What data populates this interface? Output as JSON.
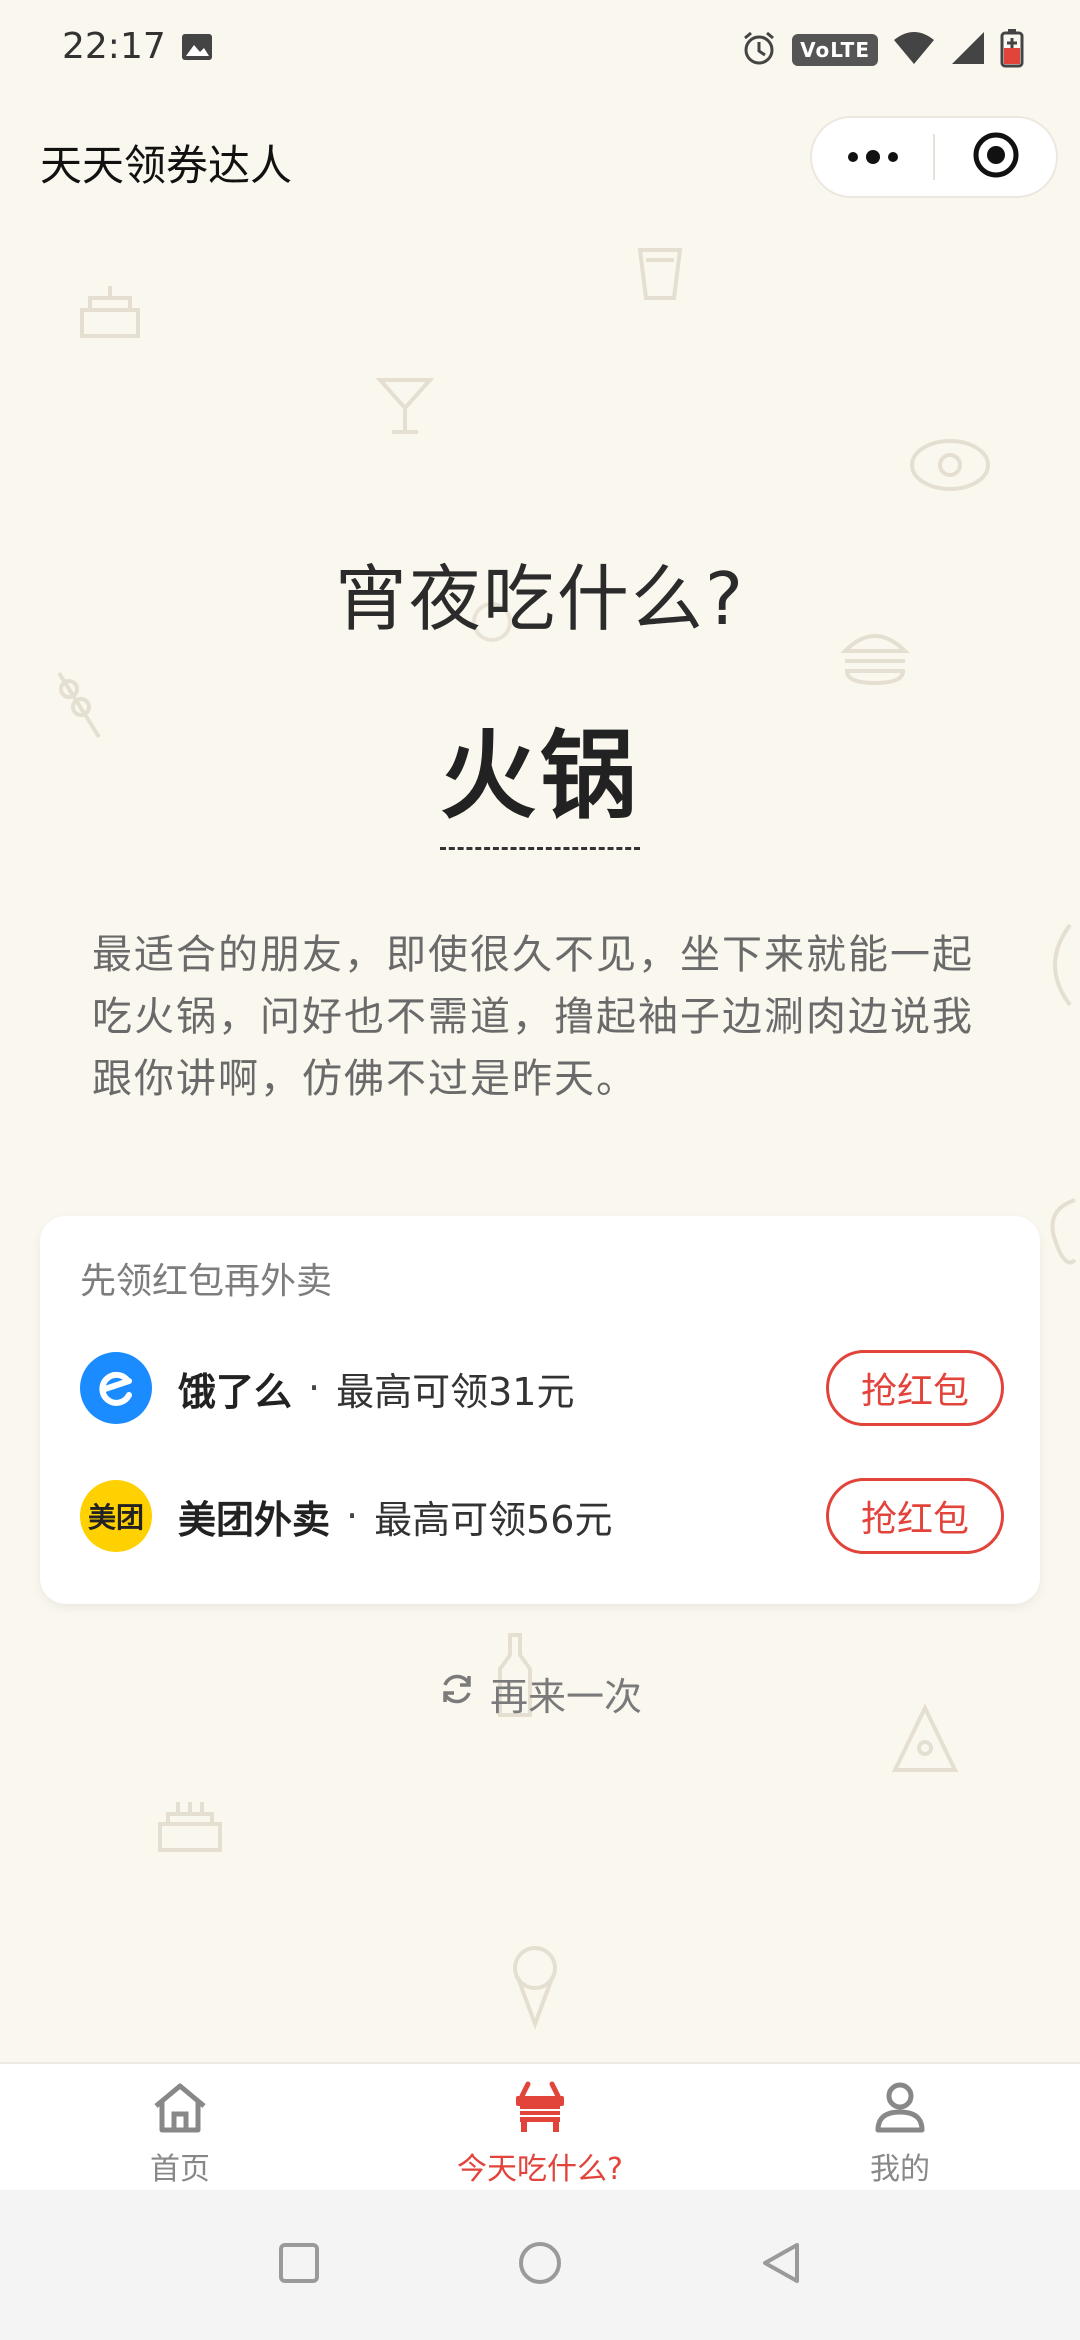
{
  "status_bar": {
    "time": "22:17",
    "volte": "VoLTE",
    "icons": [
      "image-icon",
      "alarm-icon",
      "wifi-icon",
      "signal-icon",
      "battery-charging-icon"
    ]
  },
  "nav": {
    "title": "天天领券达人",
    "icons": [
      "more-dots-icon",
      "target-close-icon"
    ]
  },
  "main": {
    "question": "宵夜吃什么?",
    "dish": "火锅",
    "description": "最适合的朋友，即使很久不见，坐下来就能一起吃火锅，问好也不需道，撸起袖子边涮肉边说我跟你讲啊，仿佛不过是昨天。"
  },
  "coupons": {
    "title": "先领红包再外卖",
    "items": [
      {
        "brand": "饿了么",
        "logo": "eleme-logo-icon",
        "separator": "·",
        "max": "最高可领31元",
        "button": "抢红包"
      },
      {
        "brand": "美团外卖",
        "logo_text": "美团",
        "separator": "·",
        "max": "最高可领56元",
        "button": "抢红包"
      }
    ]
  },
  "retry": {
    "label": "再来一次",
    "icon": "refresh-icon"
  },
  "tabs": [
    {
      "label": "首页",
      "icon": "home-icon",
      "active": false
    },
    {
      "label": "今天吃什么?",
      "icon": "table-icon",
      "active": true
    },
    {
      "label": "我的",
      "icon": "user-icon",
      "active": false
    }
  ],
  "colors": {
    "background": "#faf7ef",
    "accent": "#e2433a",
    "eleme": "#1a8cff",
    "meituan": "#ffd100"
  }
}
